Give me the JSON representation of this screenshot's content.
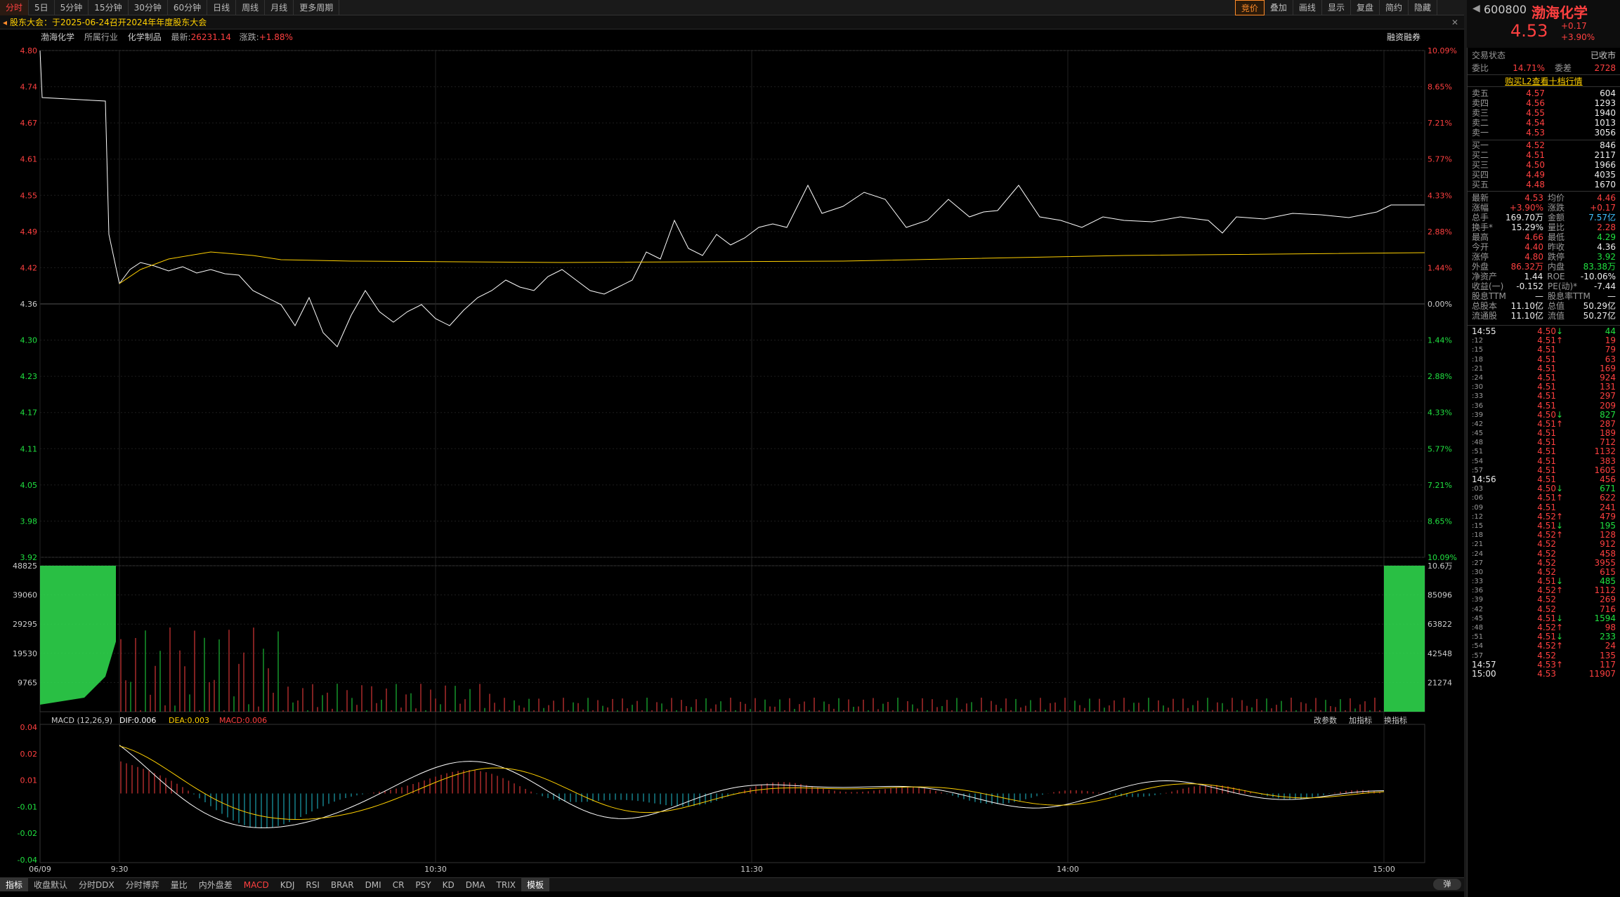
{
  "toolbar": {
    "tabs": [
      "分时",
      "5日",
      "5分钟",
      "15分钟",
      "30分钟",
      "60分钟",
      "日线",
      "周线",
      "月线",
      "更多周期"
    ],
    "right_tools": [
      "竞价",
      "叠加",
      "画线",
      "显示",
      "复盘",
      "简约",
      "隐藏"
    ]
  },
  "info": {
    "notice": "股东大会：于2025-06-24召开2024年年度股东大会",
    "stock_name": "渤海化学",
    "industry_label": "所属行业",
    "industry": "化学制品",
    "latest_label": "最新:",
    "latest": "26231.14",
    "change_label": "涨跌:",
    "change": "+1.88%",
    "margin": "融资融券"
  },
  "header": {
    "code": "600800",
    "name": "渤海化学",
    "price": "4.53",
    "chg": "+0.17",
    "pct": "+3.90%"
  },
  "axes": {
    "price_ticks": [
      "4.80",
      "4.74",
      "4.67",
      "4.61",
      "4.55",
      "4.49",
      "4.42",
      "4.36",
      "4.30",
      "4.23",
      "4.17",
      "4.11",
      "4.05",
      "3.98",
      "3.92"
    ],
    "pct_ticks": [
      "10.09%",
      "8.65%",
      "7.21%",
      "5.77%",
      "4.33%",
      "2.88%",
      "1.44%",
      "0.00%",
      "1.44%",
      "2.88%",
      "4.33%",
      "5.77%",
      "7.21%",
      "8.65%",
      "10.09%"
    ],
    "vol_ticks_left": [
      "48825",
      "39060",
      "29295",
      "19530",
      "9765"
    ],
    "vol_ticks_right": [
      "10.6万",
      "85096",
      "63822",
      "42548",
      "21274"
    ],
    "macd_ticks": [
      "0.04",
      "0.02",
      "0.01",
      "-0.01",
      "-0.02",
      "-0.04"
    ],
    "time_ticks": [
      "06/09",
      "9:30",
      "10:30",
      "11:30",
      "14:00",
      "15:00"
    ]
  },
  "macd": {
    "title": "MACD (12,26,9)",
    "dif": "DIF:0.006",
    "dea": "DEA:0.003",
    "macd": "MACD:0.006",
    "btns": [
      "改参数",
      "加指标",
      "换指标"
    ]
  },
  "bottom_tabs": [
    "指标",
    "收盘默认",
    "分时DDX",
    "分时博弈",
    "量比",
    "内外盘差",
    "MACD",
    "KDJ",
    "RSI",
    "BRAR",
    "DMI",
    "CR",
    "PSY",
    "KD",
    "DMA",
    "TRIX",
    "模板"
  ],
  "bottom_right": "弹",
  "quote": {
    "status_label": "交易状态",
    "status": "已收市",
    "wb_label": "委比",
    "wb": "14.71%",
    "wc_label": "委差",
    "wc": "2728",
    "l2": "购买L2查看十档行情",
    "asks": [
      [
        "卖五",
        "4.57",
        "604"
      ],
      [
        "卖四",
        "4.56",
        "1293"
      ],
      [
        "卖三",
        "4.55",
        "1940"
      ],
      [
        "卖二",
        "4.54",
        "1013"
      ],
      [
        "卖一",
        "4.53",
        "3056"
      ]
    ],
    "bids": [
      [
        "买一",
        "4.52",
        "846"
      ],
      [
        "买二",
        "4.51",
        "2117"
      ],
      [
        "买三",
        "4.50",
        "1966"
      ],
      [
        "买四",
        "4.49",
        "4035"
      ],
      [
        "买五",
        "4.48",
        "1670"
      ]
    ],
    "stats": [
      [
        "最新",
        "4.53",
        "均价",
        "4.46"
      ],
      [
        "涨幅",
        "+3.90%",
        "涨跌",
        "+0.17"
      ],
      [
        "总手",
        "169.70万",
        "金额",
        "7.57亿"
      ],
      [
        "换手*",
        "15.29%",
        "量比",
        "2.28"
      ],
      [
        "最高",
        "4.66",
        "最低",
        "4.29"
      ],
      [
        "今开",
        "4.40",
        "昨收",
        "4.36"
      ],
      [
        "涨停",
        "4.80",
        "跌停",
        "3.92"
      ],
      [
        "外盘",
        "86.32万",
        "内盘",
        "83.38万"
      ],
      [
        "净资产",
        "1.44",
        "ROE",
        "-10.06%"
      ],
      [
        "收益(一)",
        "-0.152",
        "PE(动)*",
        "-7.44"
      ],
      [
        "股息TTM",
        "—",
        "股息率TTM",
        "—"
      ],
      [
        "总股本",
        "11.10亿",
        "总值",
        "50.29亿"
      ],
      [
        "流通股",
        "11.10亿",
        "流值",
        "50.27亿"
      ]
    ]
  },
  "ticks": [
    [
      "14:55",
      "4.50",
      "44",
      "down"
    ],
    [
      ":12",
      "4.51",
      "19",
      "up"
    ],
    [
      ":15",
      "4.51",
      "79",
      ""
    ],
    [
      ":18",
      "4.51",
      "63",
      ""
    ],
    [
      ":21",
      "4.51",
      "169",
      ""
    ],
    [
      ":24",
      "4.51",
      "924",
      ""
    ],
    [
      ":30",
      "4.51",
      "131",
      ""
    ],
    [
      ":33",
      "4.51",
      "297",
      ""
    ],
    [
      ":36",
      "4.51",
      "209",
      ""
    ],
    [
      ":39",
      "4.50",
      "827",
      "down"
    ],
    [
      ":42",
      "4.51",
      "287",
      "up"
    ],
    [
      ":45",
      "4.51",
      "189",
      ""
    ],
    [
      ":48",
      "4.51",
      "712",
      ""
    ],
    [
      ":51",
      "4.51",
      "1132",
      ""
    ],
    [
      ":54",
      "4.51",
      "383",
      ""
    ],
    [
      ":57",
      "4.51",
      "1605",
      ""
    ],
    [
      "14:56",
      "4.51",
      "456",
      ""
    ],
    [
      ":03",
      "4.50",
      "671",
      "down"
    ],
    [
      ":06",
      "4.51",
      "622",
      "up"
    ],
    [
      ":09",
      "4.51",
      "241",
      ""
    ],
    [
      ":12",
      "4.52",
      "479",
      "up"
    ],
    [
      ":15",
      "4.51",
      "195",
      "down"
    ],
    [
      ":18",
      "4.52",
      "128",
      "up"
    ],
    [
      ":21",
      "4.52",
      "912",
      ""
    ],
    [
      ":24",
      "4.52",
      "458",
      ""
    ],
    [
      ":27",
      "4.52",
      "3955",
      ""
    ],
    [
      ":30",
      "4.52",
      "615",
      ""
    ],
    [
      ":33",
      "4.51",
      "485",
      "down"
    ],
    [
      ":36",
      "4.52",
      "1112",
      "up"
    ],
    [
      ":39",
      "4.52",
      "269",
      ""
    ],
    [
      ":42",
      "4.52",
      "716",
      ""
    ],
    [
      ":45",
      "4.51",
      "1594",
      "down"
    ],
    [
      ":48",
      "4.52",
      "98",
      "up"
    ],
    [
      ":51",
      "4.51",
      "233",
      "down"
    ],
    [
      ":54",
      "4.52",
      "24",
      "up"
    ],
    [
      ":57",
      "4.52",
      "135",
      ""
    ],
    [
      "14:57",
      "4.53",
      "117",
      "up"
    ],
    [
      "15:00",
      "4.53",
      "11907",
      ""
    ]
  ]
}
